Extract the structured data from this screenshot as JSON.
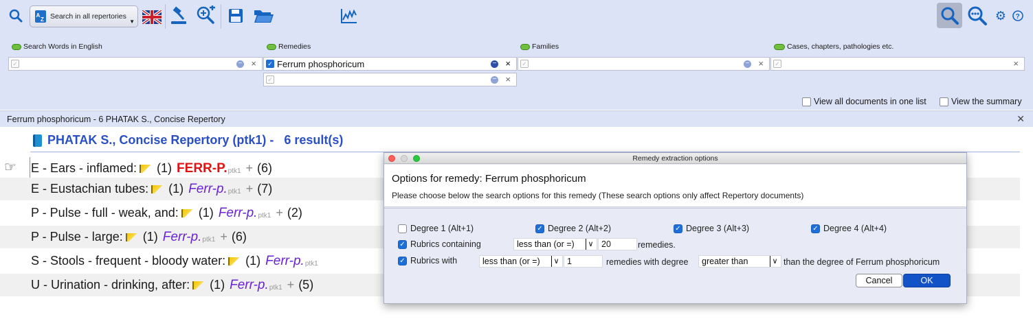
{
  "toolbar": {
    "search_all_label": "Search in all repertories",
    "icons": [
      "search-icon",
      "az-icon",
      "uk-flag-icon",
      "gavel-icon",
      "zoom-add-icon",
      "save-icon",
      "folder-open-icon",
      "chart-icon",
      "magnifier-selected-icon",
      "more-search-icon",
      "gear-icon",
      "help-icon"
    ]
  },
  "fields": {
    "words_label": "Search Words in English",
    "remedies_label": "Remedies",
    "remedies_value": "Ferrum phosphoricum",
    "families_label": "Families",
    "cases_label": "Cases, chapters, pathologies etc."
  },
  "view": {
    "all_docs_label": "View all documents in one list",
    "summary_label": "View the summary"
  },
  "doc_tab": {
    "title": "Ferrum phosphoricum - 6 PHATAK S., Concise Repertory"
  },
  "repertory": {
    "title": "PHATAK S., Concise Repertory (ptk1) -   6 result(s)",
    "rows": [
      {
        "rubric": "E - Ears - inflamed:",
        "count": "(1)",
        "remedy": "FERR-P.",
        "abbr": "ptk1",
        "plus": "+",
        "total": "(6)"
      },
      {
        "rubric": "E - Eustachian tubes:",
        "count": "(1)",
        "remedy": "Ferr-p.",
        "abbr": "ptk1",
        "plus": "+",
        "total": "(7)"
      },
      {
        "rubric": "P - Pulse - full - weak, and:",
        "count": "(1)",
        "remedy": "Ferr-p.",
        "abbr": "ptk1",
        "plus": "+",
        "total": "(2)"
      },
      {
        "rubric": "P - Pulse - large:",
        "count": "(1)",
        "remedy": "Ferr-p.",
        "abbr": "ptk1",
        "plus": "+",
        "total": "(6)"
      },
      {
        "rubric": "S - Stools - frequent - bloody water:",
        "count": "(1)",
        "remedy": "Ferr-p.",
        "abbr": "ptk1",
        "plus": "",
        "total": ""
      },
      {
        "rubric": "U - Urination - drinking, after:",
        "count": "(1)",
        "remedy": "Ferr-p.",
        "abbr": "ptk1",
        "plus": "+",
        "total": "(5)"
      }
    ]
  },
  "dialog": {
    "title": "Remedy extraction options",
    "heading": "Options for remedy: Ferrum phosphoricum",
    "description": "Please choose below the search options for this remedy (These search options only affect Repertory documents)",
    "degree1": "Degree 1 (Alt+1)",
    "degree2": "Degree 2 (Alt+2)",
    "degree3": "Degree 3 (Alt+3)",
    "degree4": "Degree 4 (Alt+4)",
    "rubrics_containing": "Rubrics containing",
    "containing_op": "less than (or =)",
    "containing_value": "20",
    "remedies_suffix": "remedies.",
    "rubrics_with": "Rubrics with",
    "with_op": "less than (or =)",
    "with_value": "1",
    "with_degree_label": "remedies with degree",
    "degree_op": "greater than",
    "degree_suffix": "than the degree of Ferrum phosphoricum",
    "cancel": "Cancel",
    "ok": "OK"
  }
}
